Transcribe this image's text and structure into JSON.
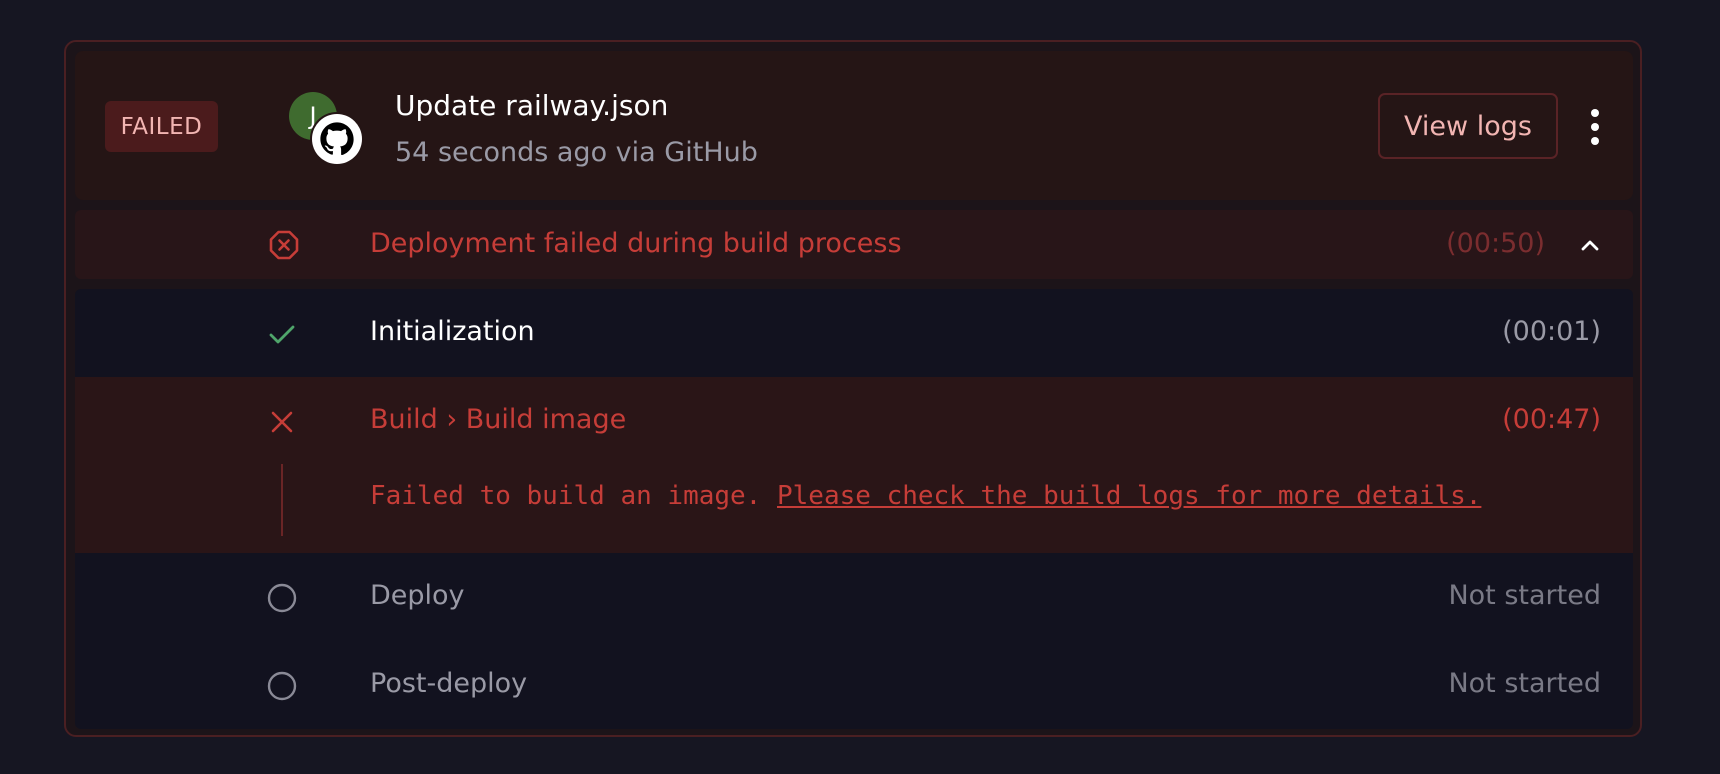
{
  "deployment": {
    "status": "FAILED",
    "avatar_initial": "J",
    "commit_title": "Update railway.json",
    "commit_meta": "54 seconds ago via GitHub",
    "view_logs_label": "View logs",
    "summary_text": "Deployment failed during build process",
    "summary_time": "(00:50)"
  },
  "steps": [
    {
      "label": "Initialization",
      "time": "(00:01)",
      "status": "success"
    },
    {
      "label": "Build › Build image",
      "time": "(00:47)",
      "status": "failed"
    },
    {
      "label": "Deploy",
      "time": "Not started",
      "status": "pending"
    },
    {
      "label": "Post-deploy",
      "time": "Not started",
      "status": "pending"
    }
  ],
  "error": {
    "message": "Failed to build an image.",
    "link_text": "Please check the build logs for more details."
  },
  "colors": {
    "error_red": "#c63d38",
    "success_green": "#4fa56b",
    "muted": "#9a9aa6",
    "badge_bg": "#4b1b1c"
  },
  "icons": {
    "summary": "x-octagon-icon",
    "expand": "chevron-up-icon",
    "more": "more-vertical-icon",
    "source": "github-icon"
  }
}
